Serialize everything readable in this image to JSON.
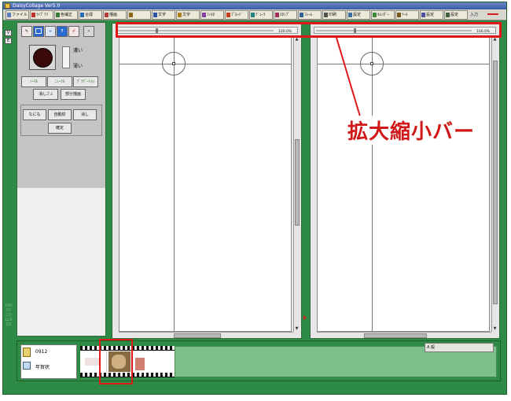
{
  "window": {
    "title": "DaisyCollage  Ver5.0"
  },
  "toolbar": {
    "buttons": [
      {
        "label": "ファイル",
        "color": "#5a7ab8"
      },
      {
        "label": "ﾗｲﾌﾞﾗﾘ",
        "color": "#c03030"
      },
      {
        "label": "色補正",
        "color": "#3a7a3a"
      },
      {
        "label": "合成",
        "color": "#2a6ab0"
      },
      {
        "label": "描画",
        "color": "#b04040"
      },
      {
        "label": "",
        "color": "#8a6a20"
      },
      {
        "label": "文字",
        "color": "#3050a0"
      },
      {
        "label": "文字",
        "color": "#b08020"
      },
      {
        "label": "ﾌｨﾙﾀ",
        "color": "#8040a0"
      },
      {
        "label": "ﾌﾟﾛｰﾄﾞ",
        "color": "#c04020"
      },
      {
        "label": "ﾃﾞｭｰﾗ",
        "color": "#208080"
      },
      {
        "label": "ｽﾀﾝﾌﾟ",
        "color": "#a03060"
      },
      {
        "label": "ﾌﾚｰﾑ",
        "color": "#306090"
      },
      {
        "label": "印刷",
        "color": "#505050"
      },
      {
        "label": "設定",
        "color": "#4070a0"
      },
      {
        "label": "ｶﾚﾝﾀﾞｰ",
        "color": "#3a8a3a"
      },
      {
        "label": "ﾂｰﾙ",
        "color": "#7a5a20"
      },
      {
        "label": "設定",
        "color": "#5050a0"
      },
      {
        "label": "設定",
        "color": "#406040"
      }
    ],
    "right_label": "入力"
  },
  "side_strip": {
    "btn1": "V",
    "btn2": "E",
    "brand": "DAISY COLLAGE"
  },
  "left_panel": {
    "density_dark": "濃い",
    "density_light": "薄い",
    "mode_buttons": [
      "ﾉｰﾏﾙ",
      "ﾆｭｰﾗﾙ",
      "ｸﾞﾗﾃﾞｰｼｮﾝ"
    ],
    "tool_buttons": [
      "消しｺﾞﾑ",
      "部分描画"
    ],
    "face_buttons": [
      "なにも",
      "自動紋",
      "消し"
    ],
    "confirm": "確定"
  },
  "canvases": {
    "left": {
      "zoom_text": "100.0%"
    },
    "right": {
      "zoom_text": "100.0%"
    }
  },
  "annotation": {
    "zoom_bar_label": "拡大縮小バー"
  },
  "bottom": {
    "doc_id": "0912",
    "doc_name": "年賀状",
    "frame_numbers": [
      "1",
      "2",
      "3",
      "4"
    ],
    "tool_strip": "A 般"
  },
  "colors": {
    "window_green": "#2e8b45",
    "highlight_red": "#e01818",
    "film_green": "#7dc08a"
  }
}
